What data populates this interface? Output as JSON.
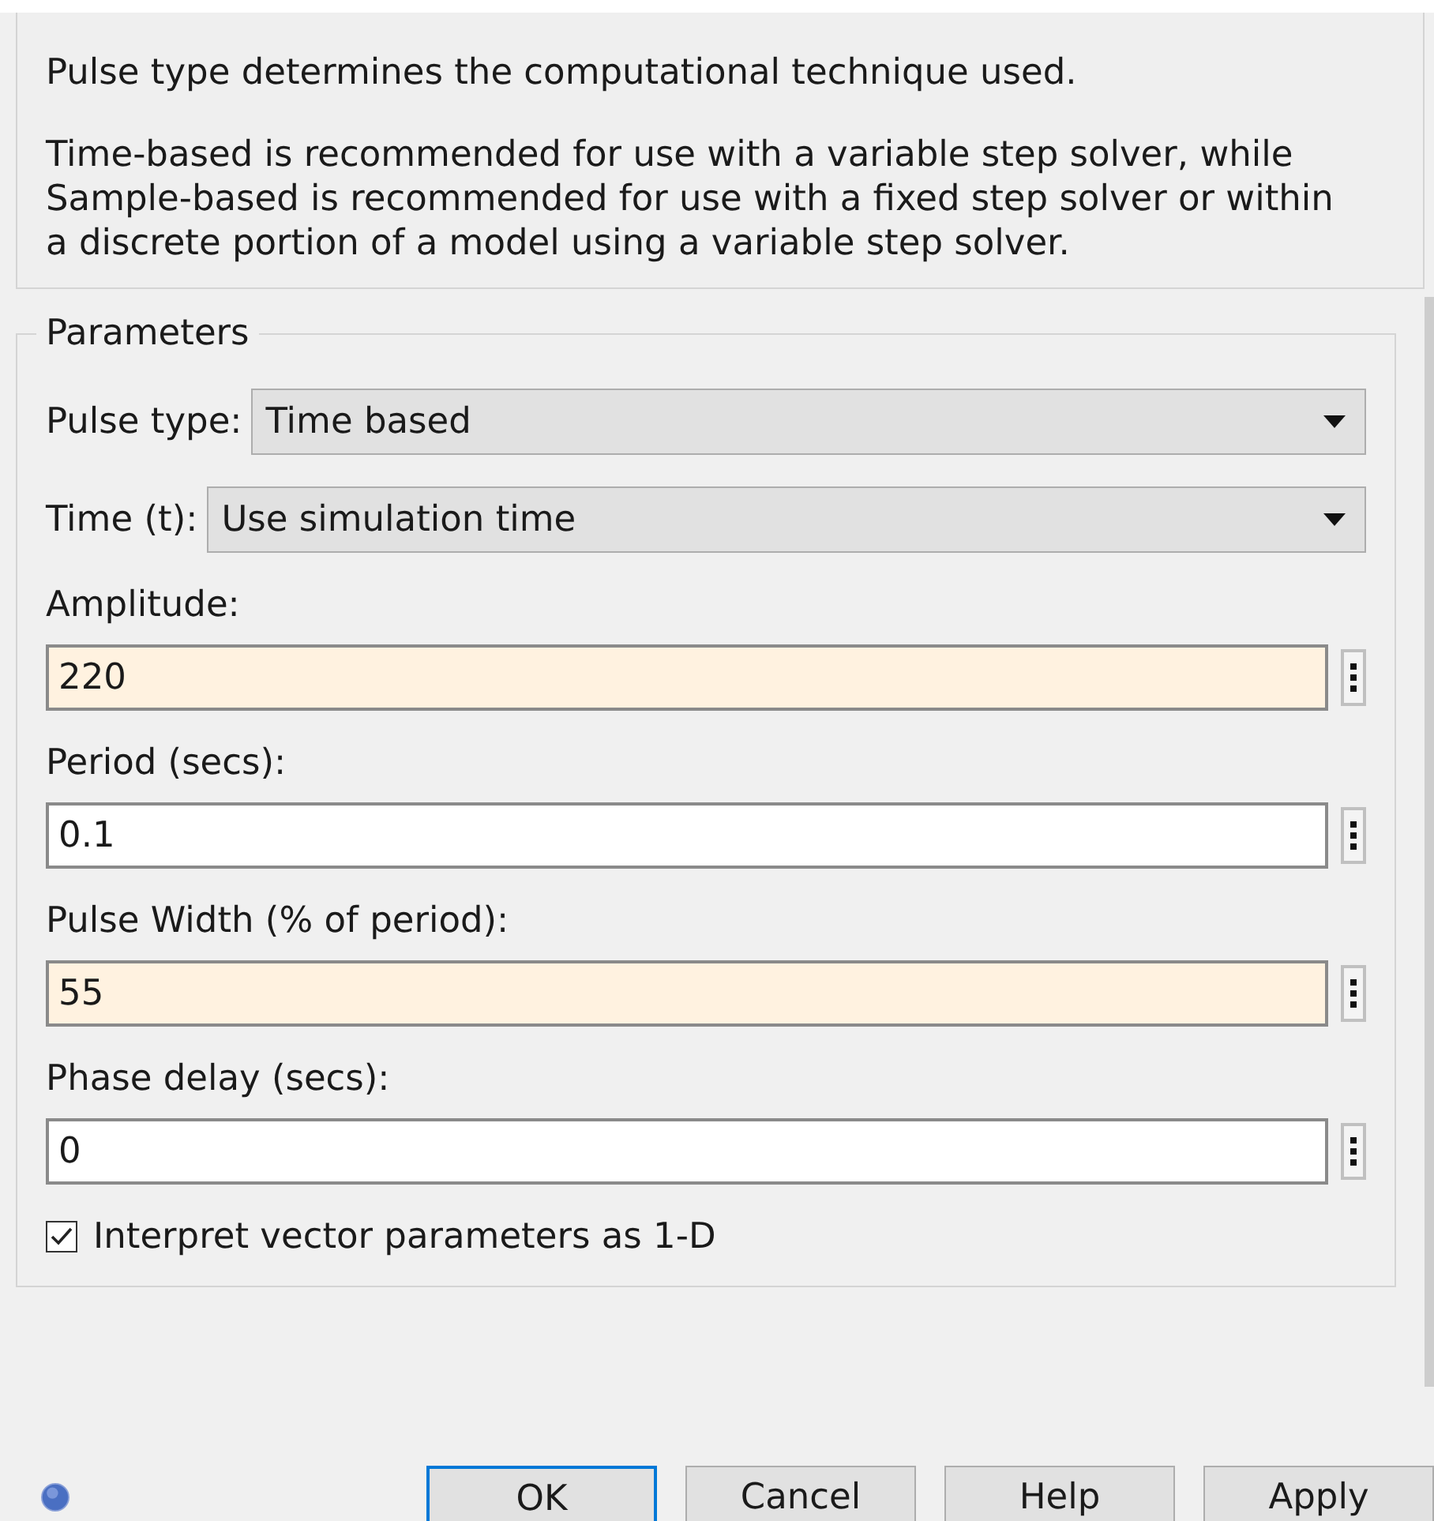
{
  "description": [
    "Pulse type determines the computational technique used.",
    "Time-based is recommended for use with a variable step solver, while Sample-based is recommended for use with a fixed step solver or within a discrete portion of a model using a variable step solver."
  ],
  "parameters": {
    "title": "Parameters",
    "dropdowns": [
      {
        "label": "Pulse type:",
        "value": "Time based"
      },
      {
        "label": "Time (t):",
        "value": "Use simulation time"
      }
    ],
    "fields": [
      {
        "label": "Amplitude:",
        "value": "220",
        "highlighted": true
      },
      {
        "label": "Period (secs):",
        "value": "0.1",
        "highlighted": false
      },
      {
        "label": "Pulse Width (% of period):",
        "value": "55",
        "highlighted": true
      },
      {
        "label": "Phase delay (secs):",
        "value": "0",
        "highlighted": false
      }
    ],
    "checkbox": {
      "label": "Interpret vector parameters as 1-D",
      "checked": true
    }
  },
  "buttons": [
    {
      "label": "OK",
      "selected": true
    },
    {
      "label": "Cancel",
      "selected": false
    },
    {
      "label": "Help",
      "selected": false
    },
    {
      "label": "Apply",
      "selected": false
    }
  ]
}
